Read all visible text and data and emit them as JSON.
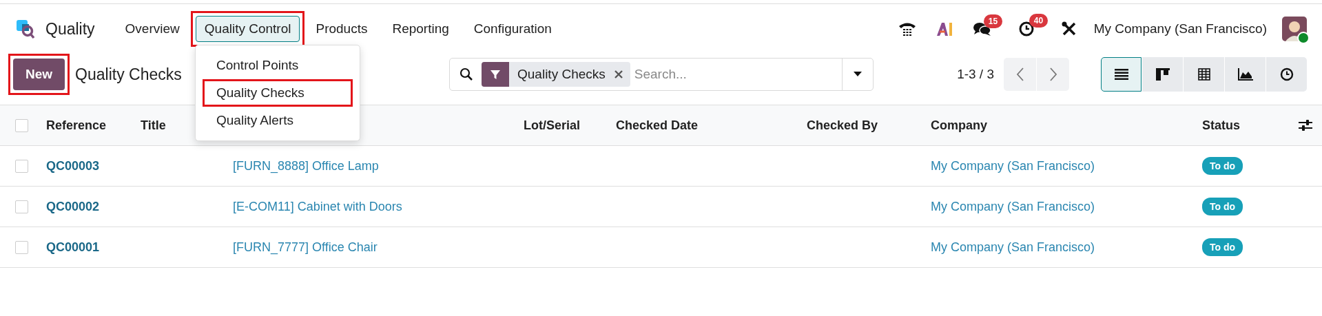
{
  "app": {
    "name": "Quality"
  },
  "nav": [
    {
      "label": "Overview",
      "selected": false,
      "highlighted": false
    },
    {
      "label": "Quality Control",
      "selected": true,
      "highlighted": true
    },
    {
      "label": "Products",
      "selected": false,
      "highlighted": false
    },
    {
      "label": "Reporting",
      "selected": false,
      "highlighted": false
    },
    {
      "label": "Configuration",
      "selected": false,
      "highlighted": false
    }
  ],
  "systray": {
    "messages_count": "15",
    "activities_count": "40",
    "company": "My Company (San Francisco)",
    "online": true
  },
  "dropdown": [
    {
      "label": "Control Points",
      "highlighted": false
    },
    {
      "label": "Quality Checks",
      "highlighted": true
    },
    {
      "label": "Quality Alerts",
      "highlighted": false
    }
  ],
  "control": {
    "new_button": {
      "label": "New",
      "highlighted": true
    },
    "title": "Quality Checks",
    "filter": "Quality Checks",
    "placeholder": "Search...",
    "pager": "1-3 / 3"
  },
  "views": [
    {
      "kind": "list",
      "selected": true
    },
    {
      "kind": "kanban",
      "selected": false
    },
    {
      "kind": "pivot",
      "selected": false
    },
    {
      "kind": "graph",
      "selected": false
    },
    {
      "kind": "activity",
      "selected": false
    }
  ],
  "table": {
    "all_checked": false,
    "columns": [
      "Reference",
      "Title",
      "Lot/Serial",
      "Checked Date",
      "Checked By",
      "Company",
      "Status"
    ],
    "rows": [
      {
        "reference": "QC00003",
        "product": "[FURN_8888] Office Lamp",
        "company": "My Company (San Francisco)",
        "status": "To do",
        "checked": false
      },
      {
        "reference": "QC00002",
        "product": "[E-COM11] Cabinet with Doors",
        "company": "My Company (San Francisco)",
        "status": "To do",
        "checked": false
      },
      {
        "reference": "QC00001",
        "product": "[FURN_7777] Office Chair",
        "company": "My Company (San Francisco)",
        "status": "To do",
        "checked": false
      }
    ]
  }
}
